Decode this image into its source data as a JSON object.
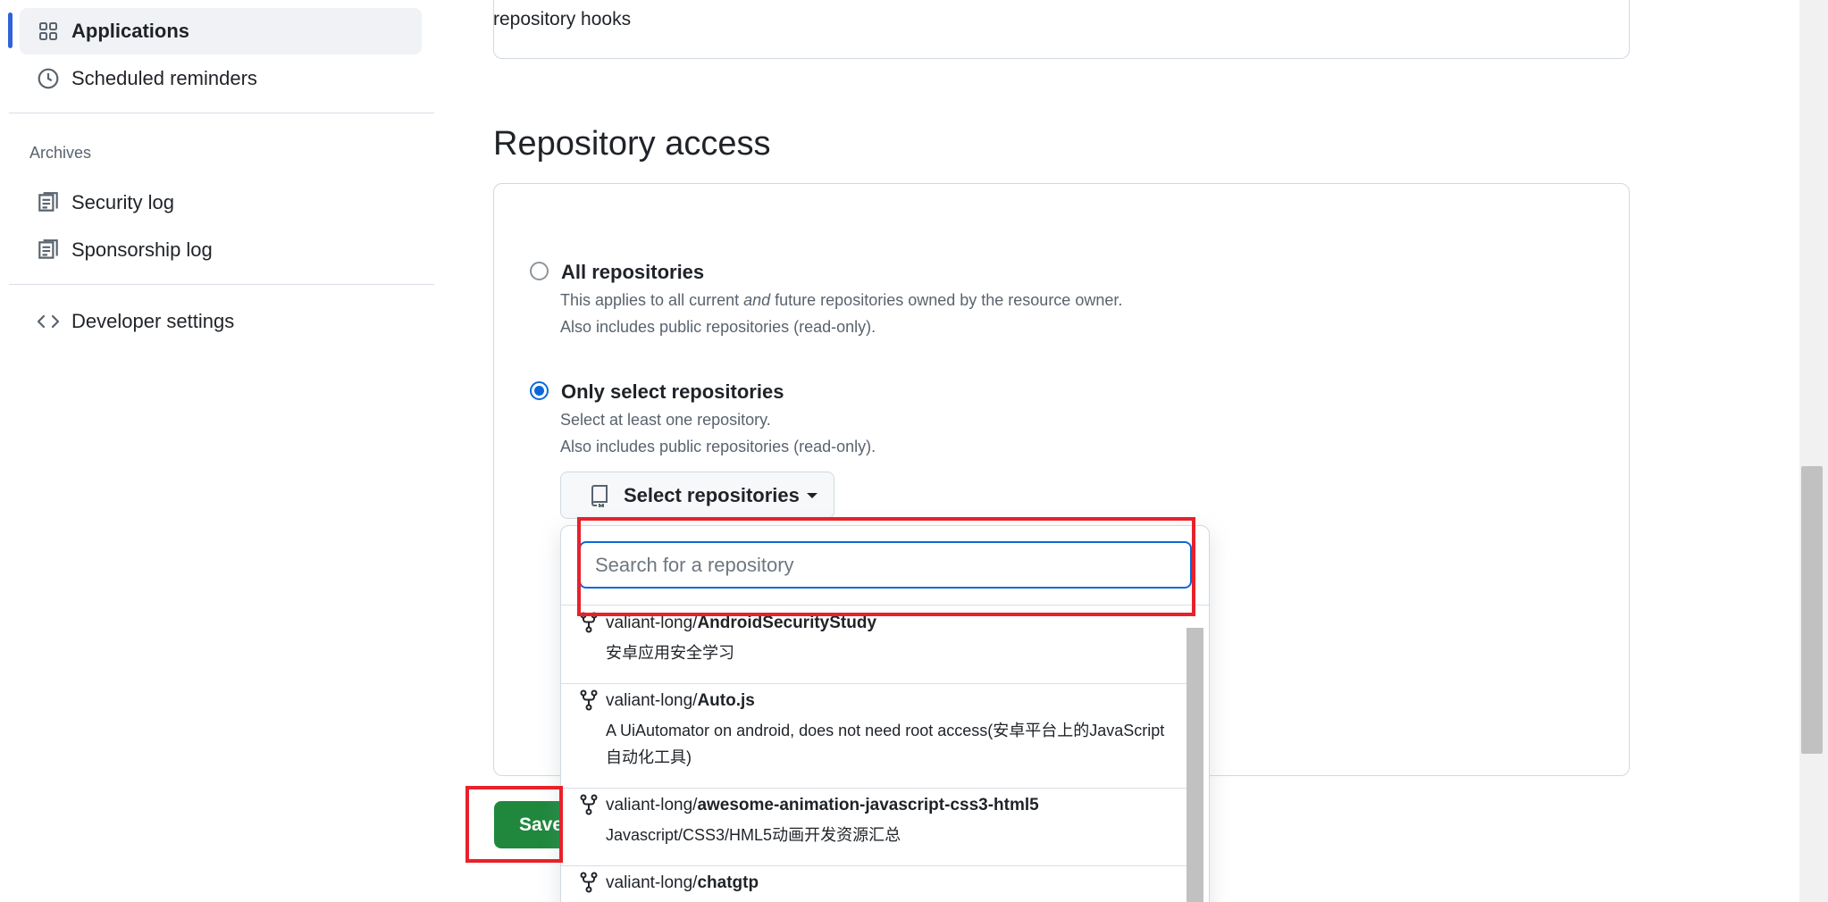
{
  "sidebar": {
    "items": [
      {
        "label": "Applications",
        "icon": "apps-grid-icon",
        "active": true
      },
      {
        "label": "Scheduled reminders",
        "icon": "clock-icon"
      }
    ],
    "archives_heading": "Archives",
    "archive_items": [
      {
        "label": "Security log",
        "icon": "log-icon"
      },
      {
        "label": "Sponsorship log",
        "icon": "log-icon"
      }
    ],
    "developer_settings": {
      "label": "Developer settings",
      "icon": "code-icon"
    }
  },
  "main": {
    "top_card_text": "repository hooks",
    "section_title": "Repository access",
    "options": [
      {
        "title": "All repositories",
        "desc_line1_before": "This applies to all current ",
        "desc_line1_em": "and",
        "desc_line1_after": " future repositories owned by the resource owner.",
        "desc_line2": "Also includes public repositories (read-only).",
        "checked": false
      },
      {
        "title": "Only select repositories",
        "desc_line1": "Select at least one repository.",
        "desc_line2": "Also includes public repositories (read-only).",
        "checked": true
      }
    ],
    "select_button_label": "Select repositories",
    "save_label": "Save"
  },
  "dropdown": {
    "search_placeholder": "Search for a repository",
    "repos": [
      {
        "owner": "valiant-long/",
        "name": "AndroidSecurityStudy",
        "desc": "安卓应用安全学习"
      },
      {
        "owner": "valiant-long/",
        "name": "Auto.js",
        "desc": "A UiAutomator on android, does not need root access(安卓平台上的JavaScript自动化工具)"
      },
      {
        "owner": "valiant-long/",
        "name": "awesome-animation-javascript-css3-html5",
        "desc": "Javascript/CSS3/HML5动画开发资源汇总"
      },
      {
        "owner": "valiant-long/",
        "name": "chatgtp",
        "desc": ""
      }
    ]
  },
  "colors": {
    "accent": "#0969da",
    "save_green": "#1f883d",
    "annotation_red": "#e8212a",
    "active_bar": "#2f63d8"
  }
}
